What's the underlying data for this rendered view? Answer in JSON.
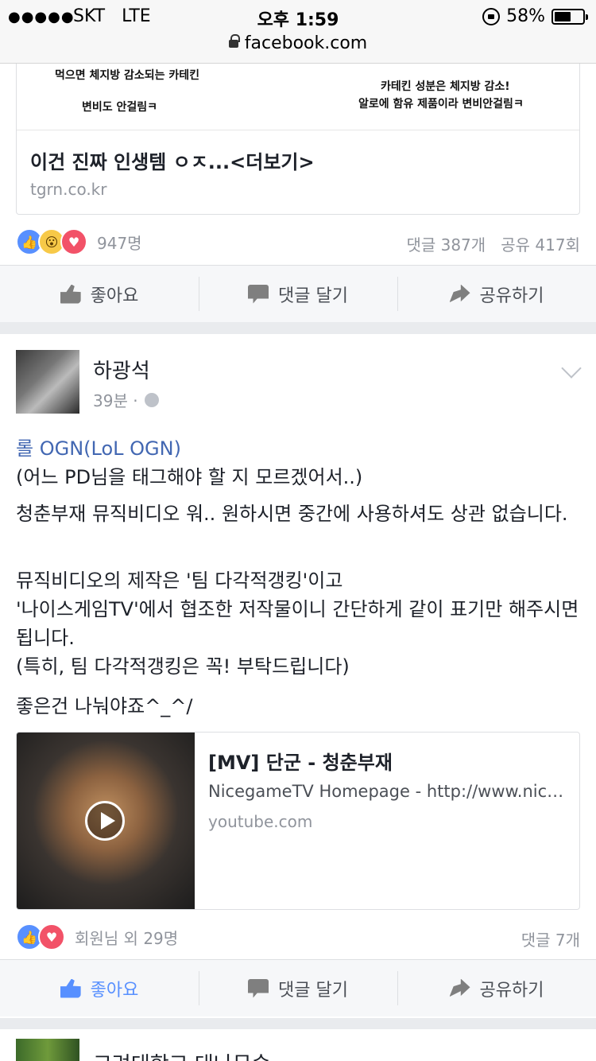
{
  "status": {
    "carrier": "SKT",
    "network": "LTE",
    "time": "오후 1:59",
    "battery": "58%",
    "battery_level": 0.58
  },
  "browser": {
    "url": "facebook.com"
  },
  "post1": {
    "image_caption": {
      "left_line1": "먹으면 체지방 감소되는 카테킨",
      "left_line2": "변비도 안걸림ㅋ",
      "right_line1": "카테킨 성분은 체지방 감소!",
      "right_line2": "알로에 함유 제품이라 변비안걸림ㅋ"
    },
    "link_title": "이건 진짜 인생템 ㅇㅈ...<더보기>",
    "link_domain": "tgrn.co.kr",
    "reaction_count": "947명",
    "comments": "댓글 387개",
    "shares": "공유 417회"
  },
  "actions": {
    "like": "좋아요",
    "comment": "댓글 달기",
    "share": "공유하기"
  },
  "post2": {
    "author": "하광석",
    "time": "39분 ·",
    "tag": "롤 OGN(LoL OGN)",
    "line_tag_note": "(어느 PD님을 태그해야 할 지 모르겠어서..)",
    "para1": "청춘부재 뮤직비디오 워.. 원하시면 중간에 사용하셔도 상관 없습니다.",
    "para2_l1": "뮤직비디오의 제작은 '팀 다각적갱킹'이고",
    "para2_l2": "'나이스게임TV'에서 협조한 저작물이니 간단하게 같이 표기만 해주시면 됩니다.",
    "para2_l3": "(특히, 팀 다각적갱킹은 꼭! 부탁드립니다)",
    "para3": "좋은건 나눠야죠^_^/",
    "video": {
      "title": "[MV] 단군 - 청춘부재",
      "desc": "NicegameTV Homepage - http://www.nicegame.tv",
      "domain": "youtube.com"
    },
    "reactions_text": "회원님 외 29명",
    "comments": "댓글 7개"
  },
  "post3": {
    "author": "고려대학교 대나무숲"
  }
}
